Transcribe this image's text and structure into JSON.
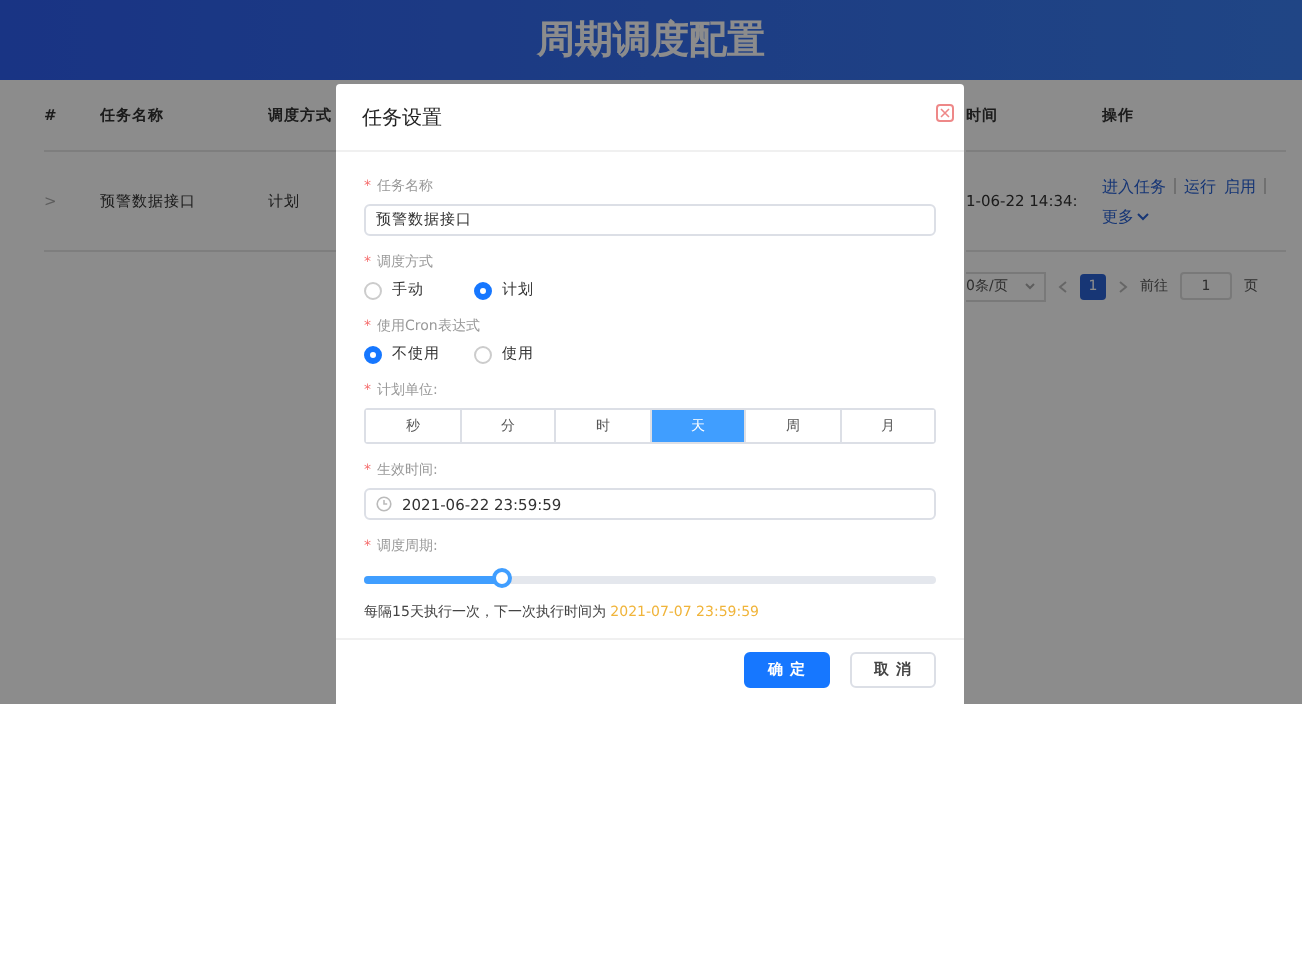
{
  "header": {
    "title": "周期调度配置"
  },
  "table": {
    "columns_left": [
      "#",
      "任务名称",
      "调度方式"
    ],
    "columns_right": [
      "时间",
      "操作"
    ],
    "rows": [
      {
        "expander": ">",
        "name": "预警数据接口",
        "mode": "计划",
        "time": "1-06-22 14:34:",
        "actions": [
          {
            "label": "进入任务"
          },
          {
            "label": "运行"
          },
          {
            "label": "启用"
          },
          {
            "label": "更多",
            "dropdown": true
          }
        ]
      }
    ]
  },
  "pagination": {
    "page_size": "0条/页",
    "pages": [
      {
        "label": "1",
        "selected": true
      }
    ],
    "goto_label": "前往",
    "goto_value": "1",
    "goto_suffix": "页"
  },
  "dialog": {
    "title": "任务设置",
    "required_mark": "*",
    "task_name": {
      "label": "任务名称",
      "value": "预警数据接口"
    },
    "schedule_mode": {
      "label": "调度方式",
      "options": [
        {
          "label": "手动",
          "selected": false
        },
        {
          "label": "计划",
          "selected": true
        }
      ]
    },
    "cron": {
      "label": "使用Cron表达式",
      "options": [
        {
          "label": "不使用",
          "selected": true
        },
        {
          "label": "使用",
          "selected": false
        }
      ]
    },
    "unit": {
      "label": "计划单位:",
      "options": [
        {
          "label": "秒",
          "selected": false
        },
        {
          "label": "分",
          "selected": false
        },
        {
          "label": "时",
          "selected": false
        },
        {
          "label": "天",
          "selected": true
        },
        {
          "label": "周",
          "selected": false
        },
        {
          "label": "月",
          "selected": false
        }
      ]
    },
    "effective": {
      "label": "生效时间:",
      "value": "2021-06-22 23:59:59"
    },
    "period": {
      "label": "调度周期:",
      "level": 0.24,
      "note": "每隔15天执行一次，下一次执行时间为",
      "next_time": "2021-07-07 23:59:59"
    },
    "buttons": [
      {
        "label": "确 定",
        "kind": "primary"
      },
      {
        "label": "取 消",
        "kind": "default"
      }
    ]
  }
}
